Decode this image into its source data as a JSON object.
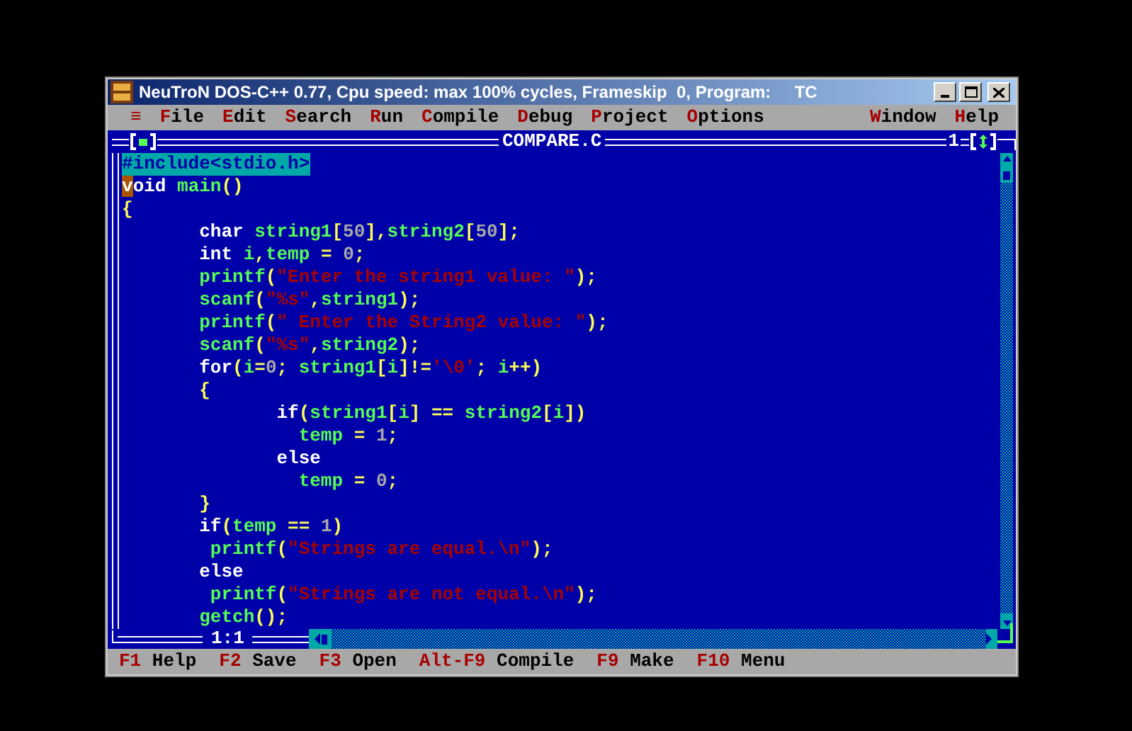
{
  "window": {
    "title": "NeuTroN DOS-C++ 0.77, Cpu speed: max 100% cycles, Frameskip  0, Program:     TC"
  },
  "menu": {
    "system": "≡",
    "left": [
      {
        "label": "File"
      },
      {
        "label": "Edit"
      },
      {
        "label": "Search"
      },
      {
        "label": "Run"
      },
      {
        "label": "Compile"
      },
      {
        "label": "Debug"
      },
      {
        "label": "Project"
      },
      {
        "label": "Options"
      }
    ],
    "right": [
      {
        "label": "Window"
      },
      {
        "label": "Help"
      }
    ]
  },
  "editor": {
    "title": "COMPARE.C",
    "window_number": "1",
    "position": "1:1",
    "lines": [
      {
        "selected": true,
        "cursor": false,
        "tokens": [
          {
            "kind": "pre",
            "text": "#include<stdio.h>"
          }
        ]
      },
      {
        "selected": false,
        "cursor": true,
        "tokens": [
          {
            "kind": "kw",
            "text": "void "
          },
          {
            "kind": "id",
            "text": "main"
          },
          {
            "kind": "op",
            "text": "()"
          }
        ]
      },
      {
        "selected": false,
        "cursor": false,
        "tokens": [
          {
            "kind": "op",
            "text": "{"
          }
        ]
      },
      {
        "selected": false,
        "cursor": false,
        "tokens": [
          {
            "kind": "kw",
            "text": "       char "
          },
          {
            "kind": "id",
            "text": "string1"
          },
          {
            "kind": "op",
            "text": "["
          },
          {
            "kind": "num",
            "text": "50"
          },
          {
            "kind": "op",
            "text": "],"
          },
          {
            "kind": "id",
            "text": "string2"
          },
          {
            "kind": "op",
            "text": "["
          },
          {
            "kind": "num",
            "text": "50"
          },
          {
            "kind": "op",
            "text": "];"
          }
        ]
      },
      {
        "selected": false,
        "cursor": false,
        "tokens": [
          {
            "kind": "kw",
            "text": "       int "
          },
          {
            "kind": "id",
            "text": "i"
          },
          {
            "kind": "op",
            "text": ","
          },
          {
            "kind": "id",
            "text": "temp"
          },
          {
            "kind": "op",
            "text": " = "
          },
          {
            "kind": "num",
            "text": "0"
          },
          {
            "kind": "op",
            "text": ";"
          }
        ]
      },
      {
        "selected": false,
        "cursor": false,
        "tokens": [
          {
            "kind": "id",
            "text": "       printf"
          },
          {
            "kind": "op",
            "text": "("
          },
          {
            "kind": "str",
            "text": "\"Enter the string1 value: \""
          },
          {
            "kind": "op",
            "text": ");"
          }
        ]
      },
      {
        "selected": false,
        "cursor": false,
        "tokens": [
          {
            "kind": "id",
            "text": "       scanf"
          },
          {
            "kind": "op",
            "text": "("
          },
          {
            "kind": "str",
            "text": "\"%s\""
          },
          {
            "kind": "op",
            "text": ","
          },
          {
            "kind": "id",
            "text": "string1"
          },
          {
            "kind": "op",
            "text": ");"
          }
        ]
      },
      {
        "selected": false,
        "cursor": false,
        "tokens": [
          {
            "kind": "id",
            "text": "       printf"
          },
          {
            "kind": "op",
            "text": "("
          },
          {
            "kind": "str",
            "text": "\" Enter the String2 value: \""
          },
          {
            "kind": "op",
            "text": ");"
          }
        ]
      },
      {
        "selected": false,
        "cursor": false,
        "tokens": [
          {
            "kind": "id",
            "text": "       scanf"
          },
          {
            "kind": "op",
            "text": "("
          },
          {
            "kind": "str",
            "text": "\"%s\""
          },
          {
            "kind": "op",
            "text": ","
          },
          {
            "kind": "id",
            "text": "string2"
          },
          {
            "kind": "op",
            "text": ");"
          }
        ]
      },
      {
        "selected": false,
        "cursor": false,
        "tokens": [
          {
            "kind": "kw",
            "text": "       for"
          },
          {
            "kind": "op",
            "text": "("
          },
          {
            "kind": "id",
            "text": "i"
          },
          {
            "kind": "op",
            "text": "="
          },
          {
            "kind": "num",
            "text": "0"
          },
          {
            "kind": "op",
            "text": "; "
          },
          {
            "kind": "id",
            "text": "string1"
          },
          {
            "kind": "op",
            "text": "["
          },
          {
            "kind": "id",
            "text": "i"
          },
          {
            "kind": "op",
            "text": "]!="
          },
          {
            "kind": "str",
            "text": "'\\0'"
          },
          {
            "kind": "op",
            "text": "; "
          },
          {
            "kind": "id",
            "text": "i"
          },
          {
            "kind": "op",
            "text": "++)"
          }
        ]
      },
      {
        "selected": false,
        "cursor": false,
        "tokens": [
          {
            "kind": "op",
            "text": "       {"
          }
        ]
      },
      {
        "selected": false,
        "cursor": false,
        "tokens": [
          {
            "kind": "kw",
            "text": "              if"
          },
          {
            "kind": "op",
            "text": "("
          },
          {
            "kind": "id",
            "text": "string1"
          },
          {
            "kind": "op",
            "text": "["
          },
          {
            "kind": "id",
            "text": "i"
          },
          {
            "kind": "op",
            "text": "] == "
          },
          {
            "kind": "id",
            "text": "string2"
          },
          {
            "kind": "op",
            "text": "["
          },
          {
            "kind": "id",
            "text": "i"
          },
          {
            "kind": "op",
            "text": "])"
          }
        ]
      },
      {
        "selected": false,
        "cursor": false,
        "tokens": [
          {
            "kind": "id",
            "text": "                temp"
          },
          {
            "kind": "op",
            "text": " = "
          },
          {
            "kind": "num",
            "text": "1"
          },
          {
            "kind": "op",
            "text": ";"
          }
        ]
      },
      {
        "selected": false,
        "cursor": false,
        "tokens": [
          {
            "kind": "kw",
            "text": "              else"
          }
        ]
      },
      {
        "selected": false,
        "cursor": false,
        "tokens": [
          {
            "kind": "id",
            "text": "                temp"
          },
          {
            "kind": "op",
            "text": " = "
          },
          {
            "kind": "num",
            "text": "0"
          },
          {
            "kind": "op",
            "text": ";"
          }
        ]
      },
      {
        "selected": false,
        "cursor": false,
        "tokens": [
          {
            "kind": "op",
            "text": "       }"
          }
        ]
      },
      {
        "selected": false,
        "cursor": false,
        "tokens": [
          {
            "kind": "kw",
            "text": "       if"
          },
          {
            "kind": "op",
            "text": "("
          },
          {
            "kind": "id",
            "text": "temp"
          },
          {
            "kind": "op",
            "text": " == "
          },
          {
            "kind": "num",
            "text": "1"
          },
          {
            "kind": "op",
            "text": ")"
          }
        ]
      },
      {
        "selected": false,
        "cursor": false,
        "tokens": [
          {
            "kind": "id",
            "text": "        printf"
          },
          {
            "kind": "op",
            "text": "("
          },
          {
            "kind": "str",
            "text": "\"Strings are equal.\\n\""
          },
          {
            "kind": "op",
            "text": ");"
          }
        ]
      },
      {
        "selected": false,
        "cursor": false,
        "tokens": [
          {
            "kind": "kw",
            "text": "       else"
          }
        ]
      },
      {
        "selected": false,
        "cursor": false,
        "tokens": [
          {
            "kind": "id",
            "text": "        printf"
          },
          {
            "kind": "op",
            "text": "("
          },
          {
            "kind": "str",
            "text": "\"Strings are not equal.\\n\""
          },
          {
            "kind": "op",
            "text": ");"
          }
        ]
      },
      {
        "selected": false,
        "cursor": false,
        "tokens": [
          {
            "kind": "id",
            "text": "       getch"
          },
          {
            "kind": "op",
            "text": "();"
          }
        ]
      }
    ]
  },
  "status_bar": [
    {
      "key": "F1",
      "label": "Help"
    },
    {
      "key": "F2",
      "label": "Save"
    },
    {
      "key": "F3",
      "label": "Open"
    },
    {
      "key": "Alt-F9",
      "label": "Compile"
    },
    {
      "key": "F9",
      "label": "Make"
    },
    {
      "key": "F10",
      "label": "Menu"
    }
  ]
}
